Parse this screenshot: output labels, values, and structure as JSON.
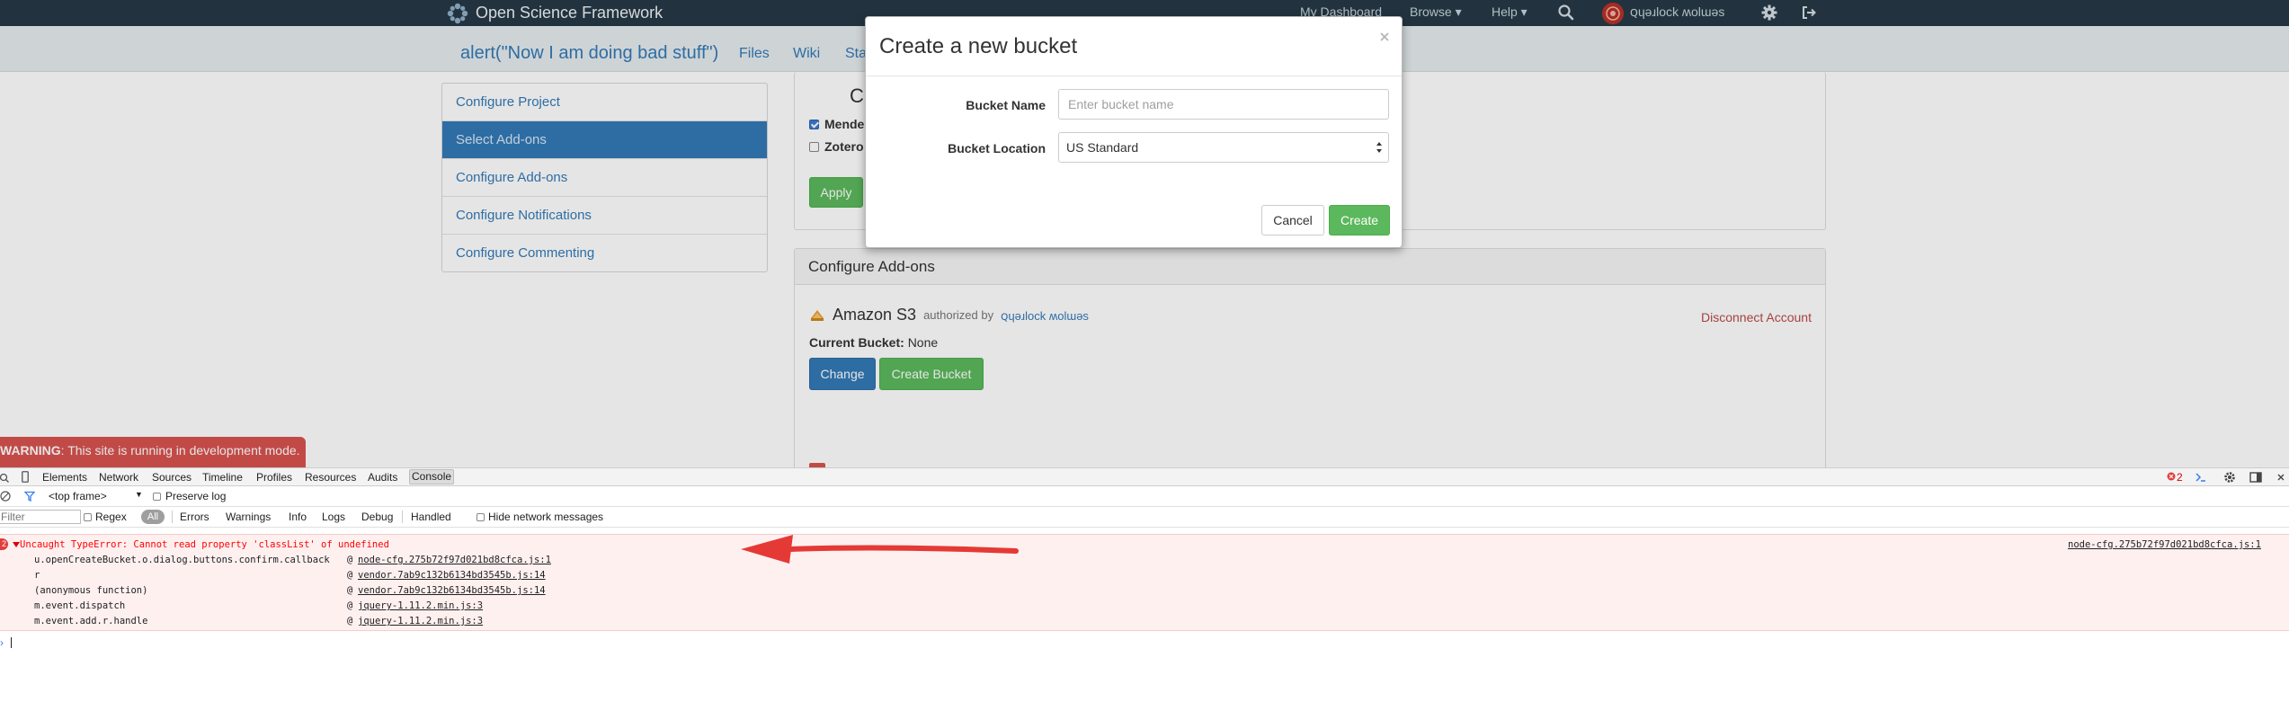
{
  "navbar": {
    "brand": "Open Science Framework",
    "links": {
      "dashboard": "My Dashboard",
      "browse": "Browse ▾",
      "help": "Help ▾"
    },
    "user_name": "ꞯɥǝɹlock ʍolɯǝs"
  },
  "project": {
    "title": "alert(\"Now I am doing bad stuff\")",
    "tabs": {
      "files": "Files",
      "wiki": "Wiki",
      "statistics": "Sta"
    }
  },
  "side_menu": {
    "items": [
      {
        "label": "Configure Project"
      },
      {
        "label": "Select Add-ons"
      },
      {
        "label": "Configure Add-ons"
      },
      {
        "label": "Configure Notifications"
      },
      {
        "label": "Configure Commenting"
      }
    ]
  },
  "citation": {
    "title": "Citatio",
    "options": [
      {
        "label": "Mende",
        "checked": true
      },
      {
        "label": "Zotero",
        "checked": false
      }
    ],
    "apply_label": "Apply"
  },
  "configure_addons": {
    "heading": "Configure Add-ons",
    "addon_name": "Amazon S3",
    "authorized_by": "authorized by",
    "user": "ꞯɥǝɹlock ʍolɯǝs",
    "disconnect_label": "Disconnect Account",
    "current_bucket_label": "Current Bucket:",
    "current_bucket_value": "None",
    "change_label": "Change",
    "create_bucket_label": "Create Bucket"
  },
  "dev_warning": {
    "prefix": "WARNING",
    "text": ": This site is running in development mode."
  },
  "modal": {
    "title": "Create a new bucket",
    "close_symbol": "×",
    "bucket_name_label": "Bucket Name",
    "bucket_name_placeholder": "Enter bucket name",
    "bucket_name_value": "",
    "bucket_location_label": "Bucket Location",
    "bucket_location_value": "US Standard",
    "cancel_label": "Cancel",
    "create_label": "Create"
  },
  "devtools": {
    "tabs": [
      "Elements",
      "Network",
      "Sources",
      "Timeline",
      "Profiles",
      "Resources",
      "Audits",
      "Console"
    ],
    "active_tab": "Console",
    "error_count": "2",
    "frame_selector": "<top frame>",
    "preserve_log": "Preserve log",
    "filter_placeholder": "Filter",
    "regex": "Regex",
    "levels": [
      "All",
      "Errors",
      "Warnings",
      "Info",
      "Logs",
      "Debug",
      "Handled"
    ],
    "hide_network": "Hide network messages",
    "error": {
      "badge": "2",
      "message": "Uncaught TypeError: Cannot read property 'classList' of undefined",
      "source": "node-cfg.275b72f97d021bd8cfca.js:1",
      "stack": [
        {
          "fn": "u.openCreateBucket.o.dialog.buttons.confirm.callback",
          "link": "node-cfg.275b72f97d021bd8cfca.js:1"
        },
        {
          "fn": "r",
          "link": "vendor.7ab9c132b6134bd3545b.js:14"
        },
        {
          "fn": "(anonymous function)",
          "link": "vendor.7ab9c132b6134bd3545b.js:14"
        },
        {
          "fn": "m.event.dispatch",
          "link": "jquery-1.11.2.min.js:3"
        },
        {
          "fn": "m.event.add.r.handle",
          "link": "jquery-1.11.2.min.js:3"
        }
      ],
      "at": "@"
    },
    "prompt": "›"
  },
  "colors": {
    "navbar": "#263947",
    "link": "#337ab7",
    "success": "#5cb85c",
    "danger": "#d9534f",
    "arrow": "#e53935"
  }
}
